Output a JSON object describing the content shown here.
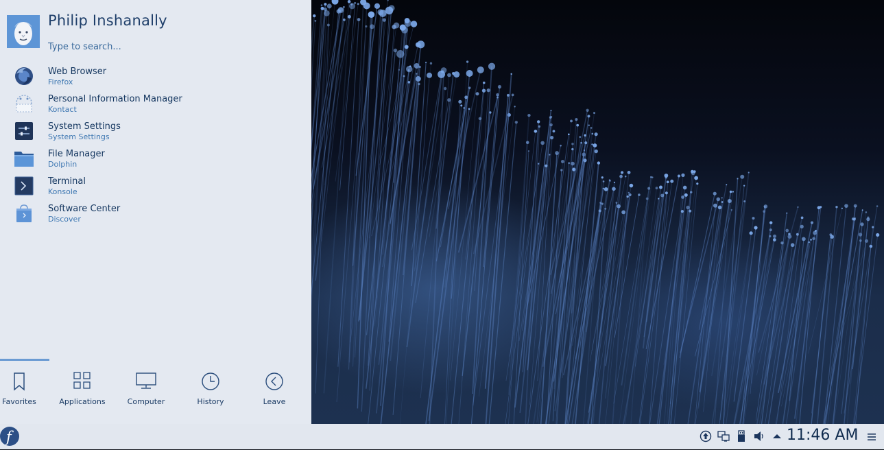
{
  "user": {
    "name": "Philip Inshanally"
  },
  "search": {
    "placeholder": "Type to search..."
  },
  "favorites": [
    {
      "title": "Web Browser",
      "subtitle": "Firefox",
      "icon": "firefox-icon"
    },
    {
      "title": "Personal Information Manager",
      "subtitle": "Kontact",
      "icon": "kontact-icon"
    },
    {
      "title": "System Settings",
      "subtitle": "System Settings",
      "icon": "system-settings-icon"
    },
    {
      "title": "File Manager",
      "subtitle": "Dolphin",
      "icon": "folder-icon"
    },
    {
      "title": "Terminal",
      "subtitle": "Konsole",
      "icon": "terminal-icon"
    },
    {
      "title": "Software Center",
      "subtitle": "Discover",
      "icon": "software-center-icon"
    }
  ],
  "tabs": [
    {
      "label": "Favorites",
      "icon": "bookmark-icon",
      "active": true
    },
    {
      "label": "Applications",
      "icon": "grid-icon",
      "active": false
    },
    {
      "label": "Computer",
      "icon": "monitor-icon",
      "active": false
    },
    {
      "label": "History",
      "icon": "clock-icon",
      "active": false
    },
    {
      "label": "Leave",
      "icon": "chevron-left-circle-icon",
      "active": false
    }
  ],
  "taskbar": {
    "clock": "11:46 AM",
    "tray_icons": [
      "updates-icon",
      "network-icon",
      "usb-device-icon",
      "volume-icon",
      "expand-tray-icon"
    ]
  },
  "colors": {
    "menu_background": "#e4e9f1",
    "accent": "#6a9bd3",
    "title_text": "#14365f",
    "subtitle_text": "#3f78b2"
  }
}
